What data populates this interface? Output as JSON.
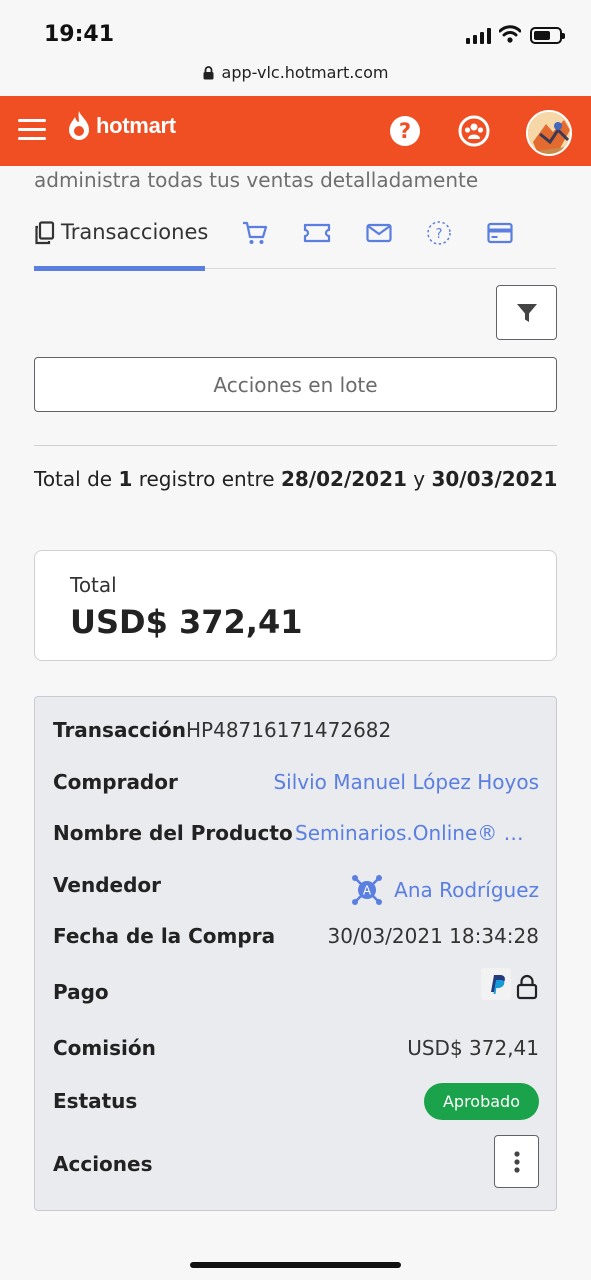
{
  "status_bar": {
    "time": "19:41"
  },
  "browser": {
    "url": "app-vlc.hotmart.com"
  },
  "header": {
    "logo_text": "hotmart"
  },
  "page": {
    "subtitle": "administra todas tus ventas detalladamente"
  },
  "tabs": [
    {
      "label": "Transacciones",
      "icon": "copy-icon",
      "active": true
    },
    {
      "label": "",
      "icon": "cart-icon"
    },
    {
      "label": "",
      "icon": "ticket-icon"
    },
    {
      "label": "",
      "icon": "mail-icon"
    },
    {
      "label": "",
      "icon": "question-dashed-icon"
    },
    {
      "label": "",
      "icon": "credit-card-icon"
    }
  ],
  "actions": {
    "batch_label": "Acciones en lote"
  },
  "summary": {
    "prefix": "Total de",
    "count": "1",
    "middle": "registro entre",
    "date_from": "28/02/2021",
    "conj": "y",
    "date_to": "30/03/2021"
  },
  "total": {
    "label": "Total",
    "value": "USD$ 372,41"
  },
  "transaction": {
    "labels": {
      "id": "Transacción",
      "buyer": "Comprador",
      "product": "Nombre del Producto",
      "seller": "Vendedor",
      "date": "Fecha de la Compra",
      "payment": "Pago",
      "commission": "Comisión",
      "status": "Estatus",
      "actions": "Acciones"
    },
    "id": "HP48716171472682",
    "buyer": "Silvio Manuel López Hoyos",
    "product": "Seminarios.Online® M...",
    "seller": "Ana Rodríguez",
    "date": "30/03/2021 18:34:28",
    "payment_method": "paypal-icon",
    "commission": "USD$ 372,41",
    "status": "Aprobado",
    "status_color": "#1aa34a"
  },
  "colors": {
    "brand": "#f04e23",
    "accent": "#5b7fe0"
  }
}
